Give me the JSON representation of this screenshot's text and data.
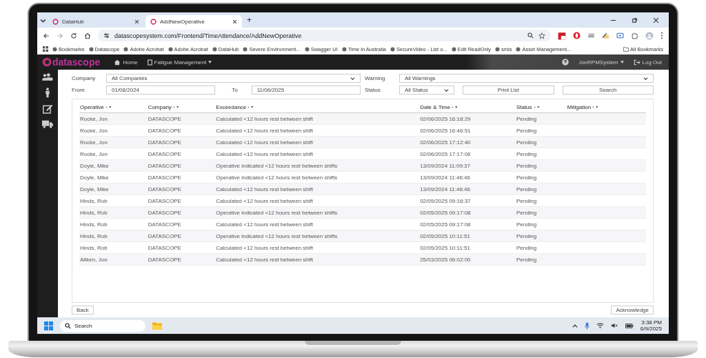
{
  "browser": {
    "tabs": [
      {
        "title": "DataHub",
        "selected": false
      },
      {
        "title": "AddNewOperative",
        "selected": true
      }
    ],
    "new_tab": "+",
    "url": "datascopesystem.com/Frontend/TimeAttendance/AddNewOperative",
    "bookmarks": [
      {
        "label": "Bookmarks"
      },
      {
        "label": "Datascope"
      },
      {
        "label": "Adobe Acrobat"
      },
      {
        "label": "Adobe Acrobat"
      },
      {
        "label": "DataHub"
      },
      {
        "label": "Severe Environment..."
      },
      {
        "label": "Swagger UI"
      },
      {
        "label": "Time in Australia"
      },
      {
        "label": "SecureVideo - List o..."
      },
      {
        "label": "Edit ReadOnly"
      },
      {
        "label": "smis"
      },
      {
        "label": "Asset Management..."
      }
    ],
    "all_bookmarks": "All Bookmarks"
  },
  "app": {
    "brand": "datascope",
    "nav": [
      {
        "label": "Home",
        "kind": "link"
      },
      {
        "label": "Fatigue Management",
        "kind": "dropdown"
      }
    ],
    "user": "JonRPMSystem",
    "logout": "Log Out"
  },
  "filters": {
    "company": {
      "label": "Company",
      "value": "All Companies"
    },
    "warning": {
      "label": "Warning",
      "value": "All Warnings"
    },
    "from": {
      "label": "From",
      "value": "01/08/2024"
    },
    "to": {
      "label": "To",
      "value": "11/06/2025"
    },
    "status": {
      "label": "Status",
      "value": "All Status"
    },
    "print_list": "Print List",
    "search": "Search"
  },
  "table": {
    "columns": [
      "Operative",
      "Company",
      "Exceedance",
      "Date & Time",
      "Status",
      "Mitigation"
    ],
    "rows": [
      [
        "Rocke, Jon",
        "DATASCOPE",
        "Calculated <12 hours rest between shift",
        "02/06/2025 16:18:29",
        "Pending"
      ],
      [
        "Rocke, Jon",
        "DATASCOPE",
        "Calculated <12 hours rest between shift",
        "02/06/2025 16:46:51",
        "Pending"
      ],
      [
        "Rocke, Jon",
        "DATASCOPE",
        "Calculated <12 hours rest between shift",
        "02/06/2025 17:12:40",
        "Pending"
      ],
      [
        "Rocke, Jon",
        "DATASCOPE",
        "Calculated <12 hours rest between shift",
        "02/06/2025 17:17:06",
        "Pending"
      ],
      [
        "Doyle, Mike",
        "DATASCOPE",
        "Operative indicated <12 hours rest between shifts",
        "13/09/2024 11:09:37",
        "Pending"
      ],
      [
        "Doyle, Mike",
        "DATASCOPE",
        "Operative indicated <12 hours rest between shifts",
        "13/09/2024 11:46:46",
        "Pending"
      ],
      [
        "Doyle, Mike",
        "DATASCOPE",
        "Calculated <12 hours rest between shift",
        "13/09/2024 11:46:46",
        "Pending"
      ],
      [
        "Hinds, Rob",
        "DATASCOPE",
        "Calculated <12 hours rest between shift",
        "02/05/2025 09:16:37",
        "Pending"
      ],
      [
        "Hinds, Rob",
        "DATASCOPE",
        "Operative indicated <12 hours rest between shifts",
        "02/05/2025 09:17:08",
        "Pending"
      ],
      [
        "Hinds, Rob",
        "DATASCOPE",
        "Calculated <12 hours rest between shift",
        "02/05/2025 09:17:08",
        "Pending"
      ],
      [
        "Hinds, Rob",
        "DATASCOPE",
        "Operative indicated <12 hours rest between shifts",
        "02/05/2025 10:11:51",
        "Pending"
      ],
      [
        "Hinds, Rob",
        "DATASCOPE",
        "Calculated <12 hours rest between shift",
        "02/05/2025 10:11:51",
        "Pending"
      ],
      [
        "Aitken, Jon",
        "DATASCOPE",
        "Calculated <12 hours rest between shift",
        "25/03/2025 06:02:00",
        "Pending"
      ]
    ]
  },
  "footer": {
    "back": "Back",
    "acknowledge": "Acknowledge"
  },
  "taskbar": {
    "search_placeholder": "Search",
    "time": "3:38 PM",
    "date": "6/9/2025"
  }
}
